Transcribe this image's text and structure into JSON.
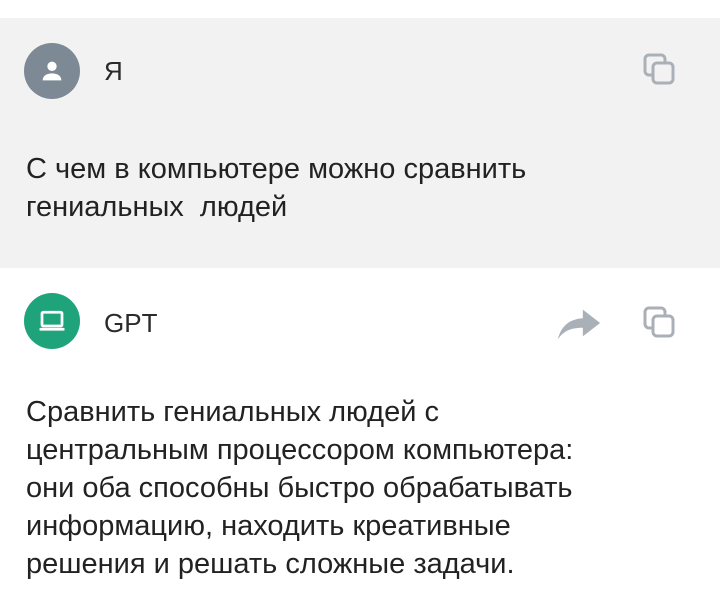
{
  "messages": {
    "user": {
      "author": "Я",
      "avatar_icon": "person-icon",
      "copy_icon": "copy-icon",
      "text": "С чем в компьютере можно сравнить\nгениальных  людей"
    },
    "bot": {
      "author": "GPT",
      "avatar_icon": "laptop-icon",
      "share_icon": "share-arrow-icon",
      "copy_icon": "copy-icon",
      "text": "Сравнить гениальных людей с\nцентральным процессором компьютера:\nони оба способны быстро обрабатывать\nинформацию, находить креативные\nрешения и решать сложные задачи."
    }
  },
  "colors": {
    "user_avatar": "#7d8a96",
    "bot_avatar": "#1fa37a",
    "user_bg": "#f2f2f2",
    "icon_gray": "#a9b0b8"
  }
}
